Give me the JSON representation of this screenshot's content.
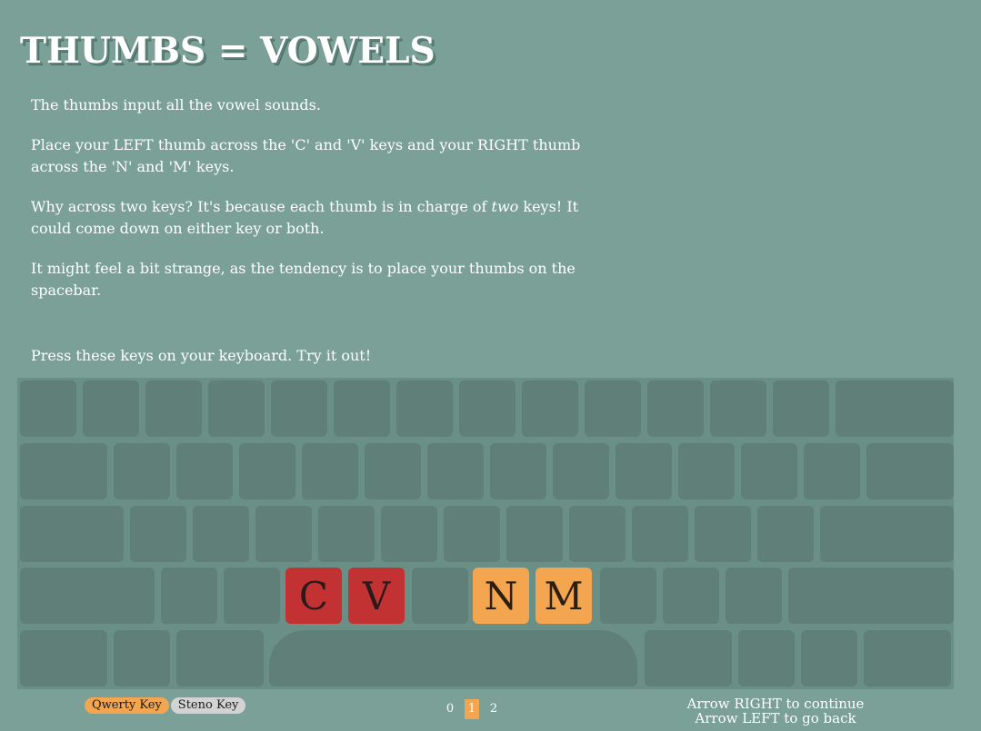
{
  "title": "THUMBS = VOWELS",
  "paragraphs": {
    "p1": "The thumbs input all the vowel sounds.",
    "p2": "Place your LEFT thumb across the 'C' and 'V' keys and your RIGHT thumb across the 'N' and 'M' keys.",
    "p3_before": "Why across two keys? It's because each thumb is in charge of ",
    "p3_em": "two",
    "p3_after": " keys! It could come down on either key or both.",
    "p4": "It might feel a bit strange, as the tendency is to place your thumbs on the spacebar."
  },
  "prompt": "Press these keys on your keyboard. Try it out!",
  "highlighted_keys": [
    {
      "label": "C",
      "color": "red"
    },
    {
      "label": "V",
      "color": "red"
    },
    {
      "label": "N",
      "color": "orange"
    },
    {
      "label": "M",
      "color": "orange"
    }
  ],
  "legend": {
    "qwerty": "Qwerty Key",
    "steno": "Steno Key"
  },
  "pager": {
    "pages": [
      "0",
      "1",
      "2"
    ],
    "current": "1"
  },
  "nav_hint": {
    "right": "Arrow RIGHT to continue",
    "left": "Arrow LEFT to go back"
  },
  "colors": {
    "background": "#7aa097",
    "keyboard": "#6a8f86",
    "key": "#5f7f78",
    "red": "#c33232",
    "orange": "#f3a54f",
    "steno_pill": "#d3d3d3"
  }
}
